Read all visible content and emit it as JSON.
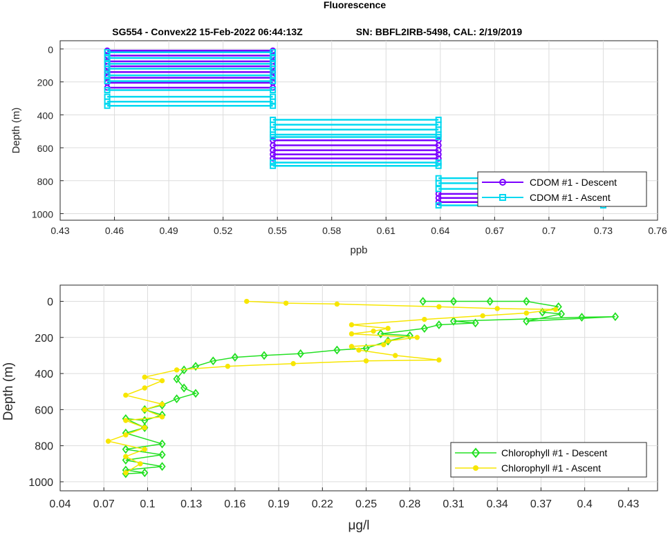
{
  "figure": {
    "title": "Fluorescence",
    "subtitle_left": "SG554 - Convex22 15-Feb-2022 06:44:13Z",
    "subtitle_right": "SN: BBFL2IRB-5498, CAL: 2/19/2019"
  },
  "chart_data": [
    {
      "type": "line",
      "xlabel": "ppb",
      "ylabel": "Depth (m)",
      "xlim": [
        0.43,
        0.76
      ],
      "ylim": [
        1040,
        -50
      ],
      "y_reversed": true,
      "grid": true,
      "legend_position": "bottom-right",
      "xticks": [
        "0.43",
        "0.46",
        "0.49",
        "0.52",
        "0.55",
        "0.58",
        "0.61",
        "0.64",
        "0.67",
        "0.7",
        "0.73",
        "0.76"
      ],
      "yticks": [
        "0",
        "200",
        "400",
        "600",
        "800",
        "1000"
      ],
      "series": [
        {
          "name": "CDOM #1 - Descent",
          "color": "#7a00ff",
          "marker": "circle",
          "segments": [
            {
              "x": [
                0.456,
                0.5475
              ],
              "y": [
                10,
                10
              ]
            },
            {
              "x": [
                0.456,
                0.5475
              ],
              "y": [
                40,
                40
              ]
            },
            {
              "x": [
                0.456,
                0.5475
              ],
              "y": [
                75,
                75
              ]
            },
            {
              "x": [
                0.456,
                0.5475
              ],
              "y": [
                105,
                105
              ]
            },
            {
              "x": [
                0.456,
                0.5475
              ],
              "y": [
                140,
                140
              ]
            },
            {
              "x": [
                0.456,
                0.5475
              ],
              "y": [
                175,
                175
              ]
            },
            {
              "x": [
                0.456,
                0.5475
              ],
              "y": [
                205,
                205
              ]
            },
            {
              "x": [
                0.456,
                0.5475
              ],
              "y": [
                235,
                235
              ]
            },
            {
              "x": [
                0.5475,
                0.639
              ],
              "y": [
                555,
                555
              ]
            },
            {
              "x": [
                0.5475,
                0.639
              ],
              "y": [
                585,
                585
              ]
            },
            {
              "x": [
                0.5475,
                0.639
              ],
              "y": [
                615,
                615
              ]
            },
            {
              "x": [
                0.5475,
                0.639
              ],
              "y": [
                640,
                640
              ]
            },
            {
              "x": [
                0.5475,
                0.639
              ],
              "y": [
                665,
                665
              ]
            },
            {
              "x": [
                0.639,
                0.73
              ],
              "y": [
                880,
                880
              ]
            },
            {
              "x": [
                0.639,
                0.73
              ],
              "y": [
                905,
                905
              ]
            },
            {
              "x": [
                0.639,
                0.73
              ],
              "y": [
                930,
                930
              ]
            }
          ]
        },
        {
          "name": "CDOM #1 - Ascent",
          "color": "#00d8f0",
          "marker": "square",
          "segments": [
            {
              "x": [
                0.456,
                0.5475
              ],
              "y": [
                20,
                20
              ]
            },
            {
              "x": [
                0.456,
                0.5475
              ],
              "y": [
                55,
                55
              ]
            },
            {
              "x": [
                0.456,
                0.5475
              ],
              "y": [
                90,
                90
              ]
            },
            {
              "x": [
                0.456,
                0.5475
              ],
              "y": [
                120,
                120
              ]
            },
            {
              "x": [
                0.456,
                0.5475
              ],
              "y": [
                160,
                160
              ]
            },
            {
              "x": [
                0.456,
                0.5475
              ],
              "y": [
                195,
                195
              ]
            },
            {
              "x": [
                0.456,
                0.5475
              ],
              "y": [
                250,
                250
              ]
            },
            {
              "x": [
                0.456,
                0.5475
              ],
              "y": [
                290,
                290
              ]
            },
            {
              "x": [
                0.456,
                0.5475
              ],
              "y": [
                320,
                320
              ]
            },
            {
              "x": [
                0.456,
                0.5475
              ],
              "y": [
                345,
                345
              ]
            },
            {
              "x": [
                0.5475,
                0.639
              ],
              "y": [
                430,
                430
              ]
            },
            {
              "x": [
                0.5475,
                0.639
              ],
              "y": [
                460,
                460
              ]
            },
            {
              "x": [
                0.5475,
                0.639
              ],
              "y": [
                490,
                490
              ]
            },
            {
              "x": [
                0.5475,
                0.639
              ],
              "y": [
                520,
                520
              ]
            },
            {
              "x": [
                0.5475,
                0.639
              ],
              "y": [
                535,
                535
              ]
            },
            {
              "x": [
                0.5475,
                0.639
              ],
              "y": [
                690,
                690
              ]
            },
            {
              "x": [
                0.5475,
                0.639
              ],
              "y": [
                710,
                710
              ]
            },
            {
              "x": [
                0.639,
                0.73
              ],
              "y": [
                785,
                785
              ]
            },
            {
              "x": [
                0.639,
                0.73
              ],
              "y": [
                815,
                815
              ]
            },
            {
              "x": [
                0.639,
                0.73
              ],
              "y": [
                850,
                850
              ]
            },
            {
              "x": [
                0.639,
                0.73
              ],
              "y": [
                950,
                950
              ]
            }
          ]
        }
      ]
    },
    {
      "type": "line",
      "xlabel": "μg/l",
      "ylabel": "Depth (m)",
      "xlim": [
        0.04,
        0.45
      ],
      "ylim": [
        1050,
        -90
      ],
      "y_reversed": true,
      "grid": true,
      "legend_position": "bottom-right",
      "xticks": [
        "0.04",
        "0.07",
        "0.1",
        "0.13",
        "0.16",
        "0.19",
        "0.22",
        "0.25",
        "0.28",
        "0.31",
        "0.34",
        "0.37",
        "0.4",
        "0.43"
      ],
      "yticks": [
        "0",
        "200",
        "400",
        "600",
        "800",
        "1000"
      ],
      "series": [
        {
          "name": "Chlorophyll #1 - Descent",
          "color": "#22e022",
          "marker": "diamond",
          "points": [
            [
              0.289,
              0
            ],
            [
              0.31,
              0
            ],
            [
              0.335,
              0
            ],
            [
              0.36,
              0
            ],
            [
              0.382,
              30
            ],
            [
              0.371,
              60
            ],
            [
              0.384,
              70
            ],
            [
              0.36,
              110
            ],
            [
              0.421,
              85
            ],
            [
              0.398,
              88
            ],
            [
              0.31,
              110
            ],
            [
              0.325,
              120
            ],
            [
              0.3,
              130
            ],
            [
              0.29,
              150
            ],
            [
              0.26,
              180
            ],
            [
              0.28,
              190
            ],
            [
              0.265,
              220
            ],
            [
              0.25,
              260
            ],
            [
              0.23,
              270
            ],
            [
              0.205,
              290
            ],
            [
              0.18,
              300
            ],
            [
              0.16,
              310
            ],
            [
              0.145,
              330
            ],
            [
              0.133,
              360
            ],
            [
              0.125,
              380
            ],
            [
              0.12,
              430
            ],
            [
              0.125,
              480
            ],
            [
              0.133,
              510
            ],
            [
              0.12,
              540
            ],
            [
              0.11,
              575
            ],
            [
              0.098,
              600
            ],
            [
              0.11,
              630
            ],
            [
              0.098,
              660
            ],
            [
              0.085,
              650
            ],
            [
              0.098,
              700
            ],
            [
              0.085,
              730
            ],
            [
              0.11,
              790
            ],
            [
              0.085,
              820
            ],
            [
              0.11,
              850
            ],
            [
              0.085,
              880
            ],
            [
              0.11,
              915
            ],
            [
              0.085,
              935
            ],
            [
              0.098,
              950
            ],
            [
              0.085,
              955
            ]
          ]
        },
        {
          "name": "Chlorophyll #1 - Ascent",
          "color": "#f7e600",
          "marker": "circle",
          "points": [
            [
              0.085,
              950
            ],
            [
              0.095,
              900
            ],
            [
              0.085,
              860
            ],
            [
              0.098,
              820
            ],
            [
              0.073,
              775
            ],
            [
              0.085,
              740
            ],
            [
              0.098,
              700
            ],
            [
              0.085,
              660
            ],
            [
              0.11,
              640
            ],
            [
              0.098,
              600
            ],
            [
              0.11,
              570
            ],
            [
              0.085,
              520
            ],
            [
              0.098,
              480
            ],
            [
              0.11,
              440
            ],
            [
              0.098,
              420
            ],
            [
              0.12,
              380
            ],
            [
              0.155,
              360
            ],
            [
              0.2,
              345
            ],
            [
              0.25,
              330
            ],
            [
              0.3,
              325
            ],
            [
              0.27,
              300
            ],
            [
              0.245,
              270
            ],
            [
              0.24,
              250
            ],
            [
              0.262,
              240
            ],
            [
              0.265,
              220
            ],
            [
              0.285,
              200
            ],
            [
              0.24,
              180
            ],
            [
              0.255,
              165
            ],
            [
              0.265,
              150
            ],
            [
              0.24,
              130
            ],
            [
              0.29,
              100
            ],
            [
              0.33,
              80
            ],
            [
              0.36,
              65
            ],
            [
              0.38,
              45
            ],
            [
              0.34,
              40
            ],
            [
              0.3,
              30
            ],
            [
              0.23,
              15
            ],
            [
              0.195,
              10
            ],
            [
              0.168,
              0
            ]
          ]
        }
      ]
    }
  ]
}
